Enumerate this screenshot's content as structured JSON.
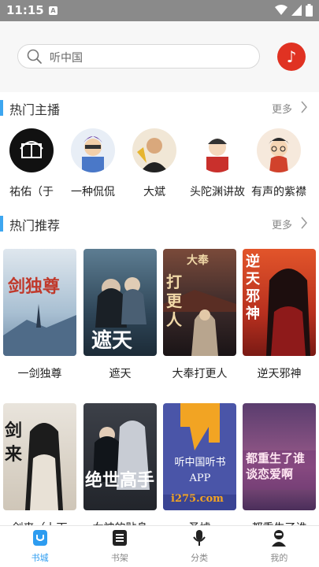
{
  "status_bar": {
    "time": "11:15",
    "notif_glyph": "A"
  },
  "search": {
    "placeholder": "听中国"
  },
  "music_button": {
    "icon": "music-note-icon",
    "glyph": "♪"
  },
  "hot_anchors": {
    "title": "热门主播",
    "more": "更多",
    "items": [
      {
        "name": "祐佑（于"
      },
      {
        "name": "一种侃侃"
      },
      {
        "name": "大斌"
      },
      {
        "name": "头陀渊讲故"
      },
      {
        "name": "有声的紫襟"
      }
    ]
  },
  "hot_recommend": {
    "title": "热门推荐",
    "more": "更多",
    "books": [
      {
        "title": "一剑独尊",
        "cover_text": "剑独尊"
      },
      {
        "title": "遮天",
        "cover_text": "遮天"
      },
      {
        "title": "大奉打更人",
        "cover_text": "打更人",
        "cover_badge": "大奉"
      },
      {
        "title": "逆天邪神",
        "cover_text": "逆天邪神"
      },
      {
        "title": "剑来（上下",
        "cover_text": "剑来"
      },
      {
        "title": "女神的贴身",
        "cover_text": "绝世高手"
      },
      {
        "title": "圣墟",
        "cover_text": "听中国听书APP",
        "cover_sub": "i275.com"
      },
      {
        "title": "都重生了谁",
        "cover_text": "都重生了谁谈恋爱啊"
      }
    ]
  },
  "bottom_nav": [
    {
      "label": "书城",
      "icon": "bookstore-icon",
      "active": true
    },
    {
      "label": "书架",
      "icon": "bookshelf-icon",
      "active": false
    },
    {
      "label": "分类",
      "icon": "microphone-icon",
      "active": false
    },
    {
      "label": "我的",
      "icon": "profile-icon",
      "active": false
    }
  ],
  "colors": {
    "accent": "#3da6f0",
    "music_button": "#e03222",
    "active_nav": "#2d9cf0"
  }
}
